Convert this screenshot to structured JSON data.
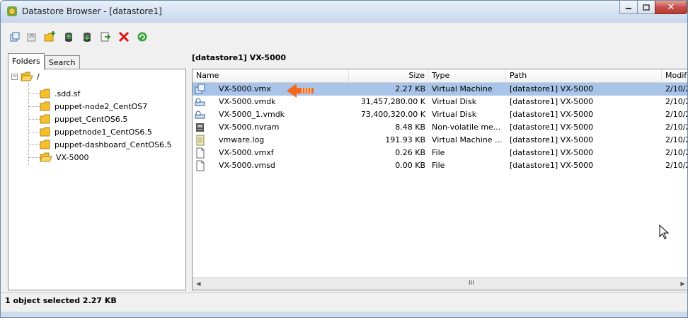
{
  "window": {
    "title": "Datastore Browser - [datastore1]",
    "controls": {
      "minimize": "minimize",
      "maximize": "maximize",
      "close": "✕"
    }
  },
  "toolbar": {
    "buttons": [
      {
        "name": "browse-datastore",
        "icon": "datastore-browse-icon"
      },
      {
        "name": "upload-from-datastore",
        "icon": "datastore-upload-icon"
      },
      {
        "name": "new-folder",
        "icon": "new-folder-icon"
      },
      {
        "name": "upload-files",
        "icon": "upload-file-icon"
      },
      {
        "name": "download-files",
        "icon": "download-file-icon"
      },
      {
        "name": "add-to-inventory",
        "icon": "register-vm-icon"
      },
      {
        "name": "delete",
        "icon": "delete-x-icon"
      },
      {
        "name": "refresh",
        "icon": "refresh-icon"
      }
    ]
  },
  "left_panel": {
    "tabs": [
      {
        "label": "Folders",
        "active": true
      },
      {
        "label": "Search",
        "active": false
      }
    ],
    "tree": {
      "root": "/",
      "expander": "⊟",
      "children": [
        ".sdd.sf",
        "puppet-node2_CentOS7",
        "puppet_CentOS6.5",
        "puppetnode1_CentOS6.5",
        "puppet-dashboard_CentOS6.5",
        "VX-5000"
      ]
    }
  },
  "right_panel": {
    "path": "[datastore1] VX-5000",
    "columns": [
      "Name",
      "Size",
      "Type",
      "Path",
      "Modif"
    ],
    "rows": [
      {
        "name": "VX-5000.vmx",
        "size": "2.27 KB",
        "type": "Virtual Machine",
        "path": "[datastore1] VX-5000",
        "modified": "2/10/2",
        "icon": "vm-icon",
        "selected": true
      },
      {
        "name": "VX-5000.vmdk",
        "size": "31,457,280.00 K",
        "type": "Virtual Disk",
        "path": "[datastore1] VX-5000",
        "modified": "2/10/2",
        "icon": "virtual-disk-icon",
        "selected": false
      },
      {
        "name": "VX-5000_1.vmdk",
        "size": "73,400,320.00 K",
        "type": "Virtual Disk",
        "path": "[datastore1] VX-5000",
        "modified": "2/10/2",
        "icon": "virtual-disk-icon",
        "selected": false
      },
      {
        "name": "VX-5000.nvram",
        "size": "8.48 KB",
        "type": "Non-volatile me...",
        "path": "[datastore1] VX-5000",
        "modified": "2/10/2",
        "icon": "nvram-icon",
        "selected": false
      },
      {
        "name": "vmware.log",
        "size": "191.93 KB",
        "type": "Virtual Machine ...",
        "path": "[datastore1] VX-5000",
        "modified": "2/10/2",
        "icon": "log-file-icon",
        "selected": false
      },
      {
        "name": "VX-5000.vmxf",
        "size": "0.26 KB",
        "type": "File",
        "path": "[datastore1] VX-5000",
        "modified": "2/10/2",
        "icon": "file-icon",
        "selected": false
      },
      {
        "name": "VX-5000.vmsd",
        "size": "0.00 KB",
        "type": "File",
        "path": "[datastore1] VX-5000",
        "modified": "2/10/2",
        "icon": "file-icon",
        "selected": false
      }
    ],
    "scrollbar": {
      "left_arrow": "◀",
      "right_arrow": "▶",
      "grip": "III"
    }
  },
  "status_bar": {
    "text": "1 object selected 2.27 KB"
  },
  "colors": {
    "selection": "#a8c4e8",
    "annotation_arrow": "#f26b1d",
    "delete_red": "#e01010",
    "folder": "#f5c02b"
  }
}
